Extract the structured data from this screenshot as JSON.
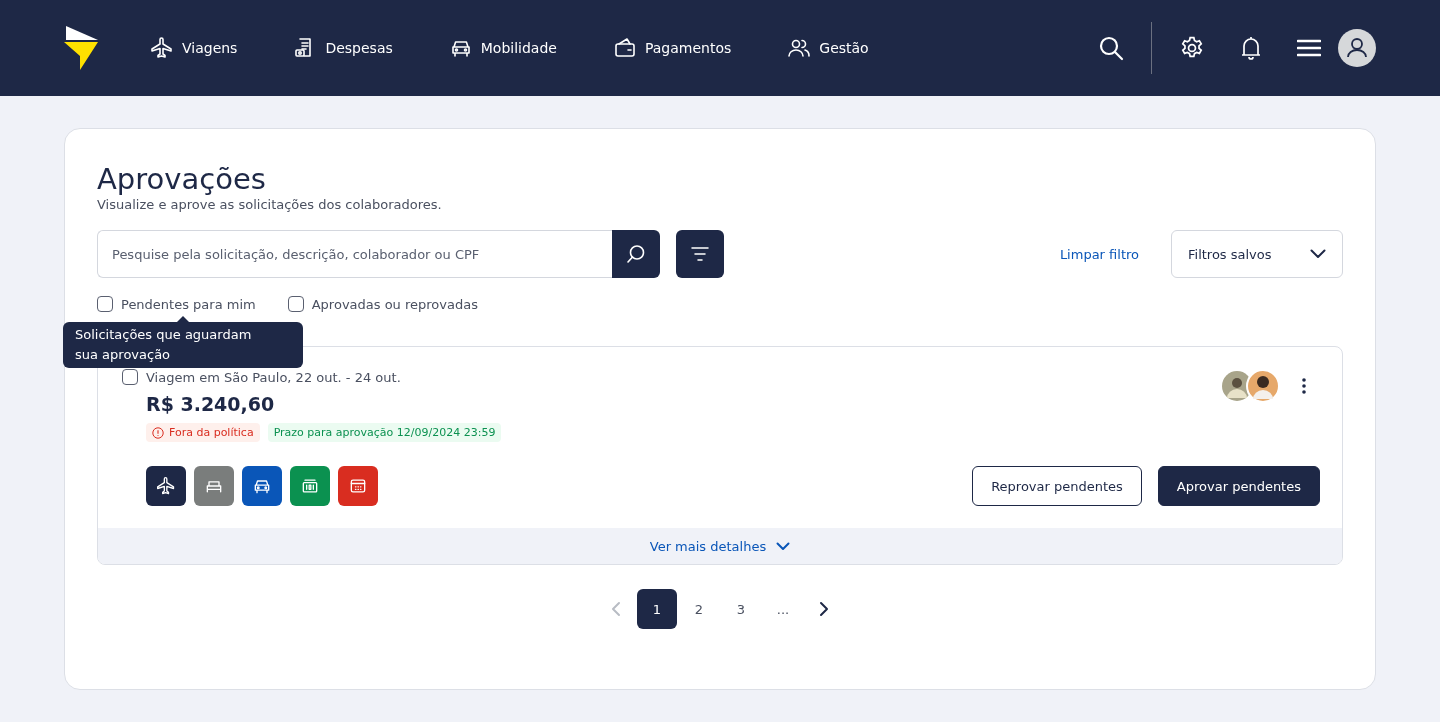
{
  "nav": {
    "items": [
      {
        "label": "Viagens",
        "kind": "plane"
      },
      {
        "label": "Despesas",
        "kind": "receipt"
      },
      {
        "label": "Mobilidade",
        "kind": "car"
      },
      {
        "label": "Pagamentos",
        "kind": "wallet"
      },
      {
        "label": "Gestão",
        "kind": "people"
      }
    ]
  },
  "page": {
    "title": "Aprovações",
    "subtitle": "Visualize e aprove as solicitações dos colaboradores."
  },
  "search": {
    "placeholder": "Pesquise pela solicitação, descrição, colaborador ou CPF"
  },
  "clear_filter": "Limpar filtro",
  "saved_filters": {
    "label": "Filtros salvos"
  },
  "checkboxes": [
    {
      "label": "Pendentes para mim",
      "checked": false
    },
    {
      "label": "Aprovadas ou reprovadas",
      "checked": false
    }
  ],
  "tooltip": "Solicitações que aguardam sua aprovação",
  "requests": [
    {
      "title": "Viagem em São Paulo, 22 out. - 24 out.",
      "checked": false,
      "amount": "R$ 3.240,60",
      "tags": [
        {
          "label": "Fora da política",
          "kind": "warning"
        },
        {
          "label": "Prazo para aprovação 12/09/2024 23:59",
          "kind": "deadline"
        }
      ],
      "services": [
        {
          "kind": "plane",
          "color": "#1e2846"
        },
        {
          "kind": "bed",
          "color": "#7a7d7c"
        },
        {
          "kind": "car",
          "color": "#0a56b8"
        },
        {
          "kind": "money",
          "color": "#0b9150"
        },
        {
          "kind": "calendar",
          "color": "#d92d20"
        }
      ],
      "reject_button": "Reprovar pendentes",
      "approve_button": "Aprovar pendentes",
      "details_link": "Ver mais detalhes"
    }
  ],
  "pagination": {
    "prev_disabled": true,
    "pages": [
      {
        "label": "1",
        "selected": true
      },
      {
        "label": "2",
        "selected": false
      },
      {
        "label": "3",
        "selected": false
      },
      {
        "label": "...",
        "selected": false
      }
    ]
  }
}
